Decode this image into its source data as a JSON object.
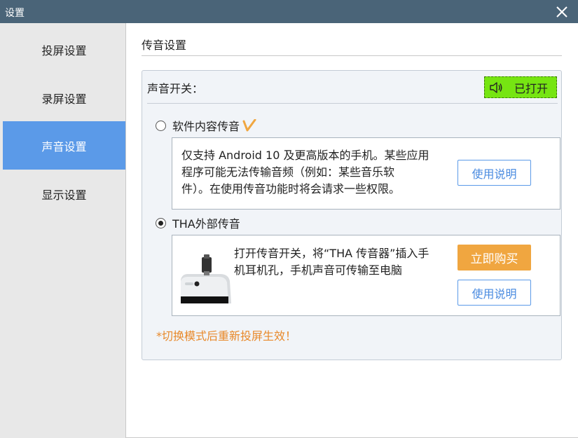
{
  "window": {
    "title": "设置",
    "close_icon": "close-icon"
  },
  "sidebar": {
    "items": [
      {
        "label": "投屏设置"
      },
      {
        "label": "录屏设置"
      },
      {
        "label": "声音设置"
      },
      {
        "label": "显示设置"
      }
    ],
    "active_index": 2
  },
  "content": {
    "section_title": "传音设置",
    "sound_switch": {
      "label": "声音开关：",
      "button_label": "已打开",
      "icon": "speaker-icon"
    },
    "option_software": {
      "label": "软件内容传音",
      "selected": false,
      "mark_icon": "v-badge-icon",
      "description_lines": [
        "仅支持 Android 10 及更高版本的手机。某些应用",
        "程序可能无法传输音频（例如：某些音乐软",
        "件）。在使用传音功能时将会请求一些权限。"
      ],
      "help_button": "使用说明"
    },
    "option_tha": {
      "label": "THA外部传音",
      "selected": true,
      "description_lines": [
        "打开传音开关，将“THA 传音器”插入手",
        "机耳机孔，手机声音可传输至电脑"
      ],
      "buy_button": "立即购买",
      "help_button": "使用说明"
    },
    "note": "*切换模式后重新投屏生效！"
  },
  "colors": {
    "titlebar": "#4a6478",
    "active_nav": "#5b9ae8",
    "toggle_on": "#76e512",
    "accent_orange": "#f0a640",
    "note_orange": "#e8892a"
  }
}
